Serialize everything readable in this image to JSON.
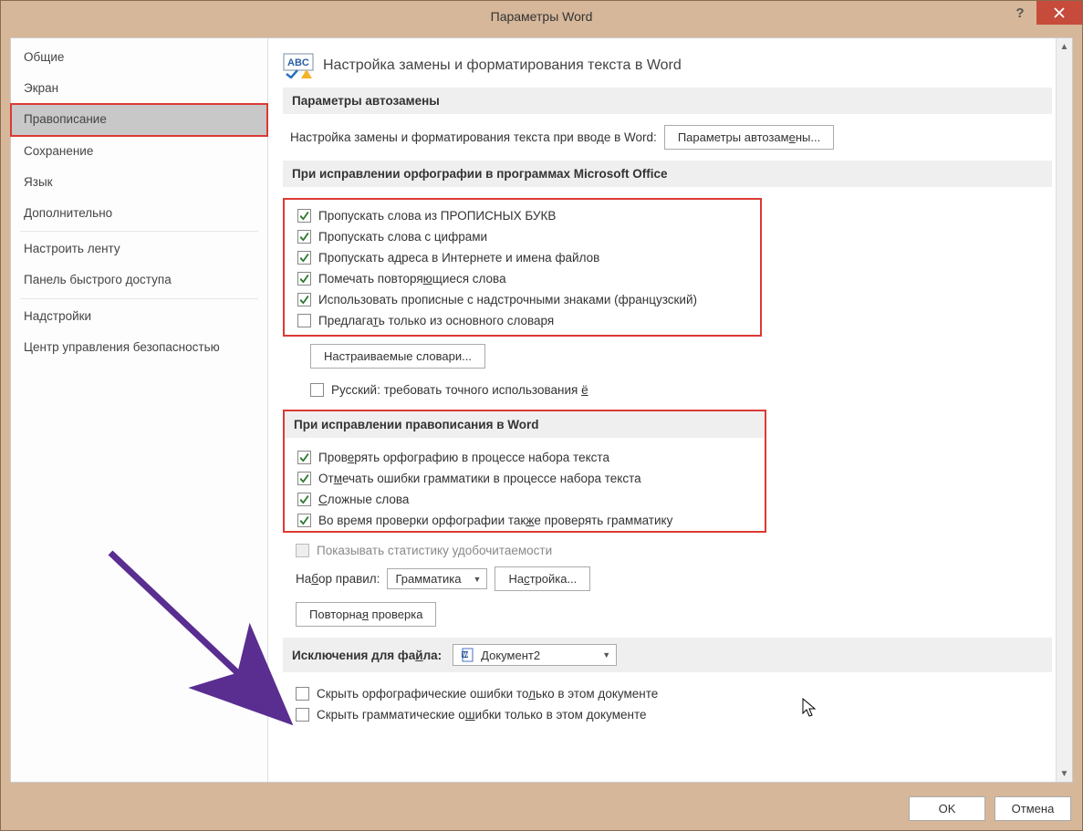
{
  "title": "Параметры Word",
  "sidebar": {
    "items": [
      {
        "label": "Общие"
      },
      {
        "label": "Экран"
      },
      {
        "label": "Правописание",
        "selected": true,
        "highlighted": true
      },
      {
        "label": "Сохранение"
      },
      {
        "label": "Язык"
      },
      {
        "label": "Дополнительно"
      }
    ],
    "group2": [
      {
        "label": "Настроить ленту"
      },
      {
        "label": "Панель быстрого доступа"
      }
    ],
    "group3": [
      {
        "label": "Надстройки"
      },
      {
        "label": "Центр управления безопасностью"
      }
    ]
  },
  "main": {
    "heading": "Настройка замены и форматирования текста в Word",
    "section_autocorrect": {
      "title": "Параметры автозамены",
      "desc": "Настройка замены и форматирования текста при вводе в Word:",
      "button": "Параметры автозам"
    },
    "section_spelling_office": {
      "title": "При исправлении орфографии в программах Microsoft Office",
      "checks": [
        {
          "label_pre": "Пропускать слова из ПРОПИСНЫХ БУКВ",
          "u": "",
          "label_post": "",
          "checked": true
        },
        {
          "label_pre": "Пропускать слова с цифрами",
          "u": "",
          "label_post": "",
          "checked": true
        },
        {
          "label_pre": "Пропускать адреса в Интернете и имена файлов",
          "u": "",
          "label_post": "",
          "checked": true
        },
        {
          "label_pre": "Помечать повторя",
          "u": "ю",
          "label_post": "щиеся слова",
          "checked": true
        },
        {
          "label_pre": "Использовать прописные с надстрочными знаками (французский)",
          "u": "",
          "label_post": "",
          "checked": true
        },
        {
          "label_pre": "Предлага",
          "u": "т",
          "label_post": "ь только из основного словаря",
          "checked": false
        }
      ],
      "dict_button": "Настраиваемые словари...",
      "russian_e": {
        "pre": "Русский: требовать точного использования ",
        "u": "ё",
        "checked": false
      }
    },
    "section_spelling_word": {
      "title": "При исправлении правописания в Word",
      "checks": [
        {
          "label_pre": "Пров",
          "u": "е",
          "label_post": "рять орфографию в процессе набора текста",
          "checked": true
        },
        {
          "label_pre": "От",
          "u": "м",
          "label_post": "ечать ошибки грамматики в процессе набора текста",
          "checked": true
        },
        {
          "label_pre": "",
          "u": "С",
          "label_post": "ложные слова",
          "checked": true
        },
        {
          "label_pre": "Во время проверки орфографии так",
          "u": "ж",
          "label_post": "е проверять грамматику",
          "checked": true
        }
      ],
      "stats": {
        "label": "Показывать статистику удобочитаемости",
        "checked": false,
        "disabled": true
      },
      "ruleset_label_pre": "На",
      "ruleset_u": "б",
      "ruleset_label_post": "ор правил:",
      "ruleset_value": "Грамматика",
      "settings_button_pre": "На",
      "settings_u": "с",
      "settings_button_post": "тройка...",
      "recheck_button_pre": "Повторна",
      "recheck_u": "я",
      "recheck_button_post": " проверка"
    },
    "section_exceptions": {
      "title_pre": "Исключения для фа",
      "title_u": "й",
      "title_post": "ла:",
      "doc": "Документ2",
      "hide_spelling": {
        "pre": "Скрыть орфографические ошибки то",
        "u": "л",
        "post": "ько в этом документе",
        "checked": false
      },
      "hide_grammar": {
        "pre": "Скрыть грамматические о",
        "u": "ш",
        "post": "ибки только в этом документе",
        "checked": false
      }
    }
  },
  "footer": {
    "ok": "OK",
    "cancel": "Отмена"
  },
  "autocorrect_u": "е",
  "autocorrect_post": "ны..."
}
